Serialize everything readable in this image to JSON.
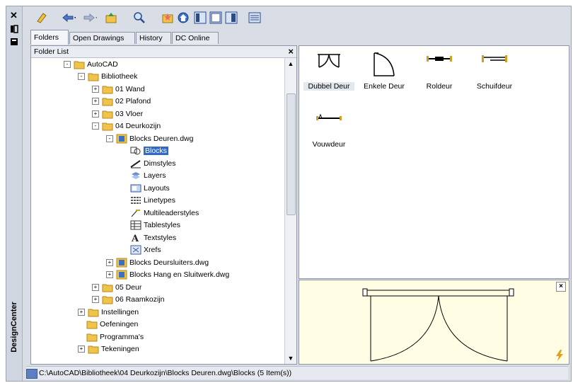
{
  "window": {
    "title": "DesignCenter",
    "close_glyph": "✕",
    "colors": {
      "frame": "#d8dde6",
      "selection": "#316ac5",
      "preview_bg": "#fffde4",
      "folder": "#f2c34b"
    }
  },
  "toolbar": {
    "buttons": [
      {
        "name": "load-icon"
      },
      {
        "name": "back-icon"
      },
      {
        "name": "forward-icon"
      },
      {
        "name": "up-icon"
      },
      {
        "name": "search-icon"
      },
      {
        "name": "favorites-icon"
      },
      {
        "name": "home-icon"
      },
      {
        "name": "tree-view-toggle-icon"
      },
      {
        "name": "preview-toggle-icon"
      },
      {
        "name": "description-toggle-icon"
      },
      {
        "name": "views-icon"
      }
    ]
  },
  "tabs": [
    {
      "label": "Folders",
      "active": true
    },
    {
      "label": "Open Drawings",
      "active": false
    },
    {
      "label": "History",
      "active": false
    },
    {
      "label": "DC Online",
      "active": false
    }
  ],
  "folder_list": {
    "header": "Folder List",
    "nodes": [
      {
        "label": "AutoCAD",
        "icon": "folder",
        "exp": "-"
      },
      {
        "label": "Bibliotheek",
        "icon": "folder",
        "exp": "-"
      },
      {
        "label": "01 Wand",
        "icon": "folder",
        "exp": "+"
      },
      {
        "label": "02 Plafond",
        "icon": "folder",
        "exp": "+"
      },
      {
        "label": "03 Vloer",
        "icon": "folder",
        "exp": "+"
      },
      {
        "label": "04 Deurkozijn",
        "icon": "folder",
        "exp": "-"
      },
      {
        "label": "Blocks Deuren.dwg",
        "icon": "dwg",
        "exp": "-"
      },
      {
        "label": "Blocks",
        "icon": "blocks",
        "selected": true
      },
      {
        "label": "Dimstyles",
        "icon": "dimstyles"
      },
      {
        "label": "Layers",
        "icon": "layers"
      },
      {
        "label": "Layouts",
        "icon": "layouts"
      },
      {
        "label": "Linetypes",
        "icon": "linetypes"
      },
      {
        "label": "Multileaderstyles",
        "icon": "multileader"
      },
      {
        "label": "Tablestyles",
        "icon": "tablestyles"
      },
      {
        "label": "Textstyles",
        "icon": "textstyles"
      },
      {
        "label": "Xrefs",
        "icon": "xrefs"
      },
      {
        "label": "Blocks Deursluiters.dwg",
        "icon": "dwg",
        "exp": "+"
      },
      {
        "label": "Blocks Hang en Sluitwerk.dwg",
        "icon": "dwg",
        "exp": "+"
      },
      {
        "label": "05 Deur",
        "icon": "folder",
        "exp": "+"
      },
      {
        "label": "06 Raamkozijn",
        "icon": "folder",
        "exp": "+"
      },
      {
        "label": "Instellingen",
        "icon": "folder",
        "exp": "+"
      },
      {
        "label": "Oefeningen",
        "icon": "folder"
      },
      {
        "label": "Programma's",
        "icon": "folder"
      },
      {
        "label": "Tekeningen",
        "icon": "folder",
        "exp": "+"
      }
    ]
  },
  "content": {
    "items": [
      {
        "label": "Dubbel Deur",
        "icon": "double-door-icon",
        "selected": true
      },
      {
        "label": "Enkele Deur",
        "icon": "single-door-icon"
      },
      {
        "label": "Roldeur",
        "icon": "roller-door-icon"
      },
      {
        "label": "Schuifdeur",
        "icon": "sliding-door-icon"
      },
      {
        "label": "Vouwdeur",
        "icon": "folding-door-icon"
      }
    ]
  },
  "preview": {
    "close_glyph": "×"
  },
  "status": {
    "path": "C:\\AutoCAD\\Bibliotheek\\04 Deurkozijn\\Blocks Deuren.dwg\\Blocks (5 Item(s))"
  }
}
